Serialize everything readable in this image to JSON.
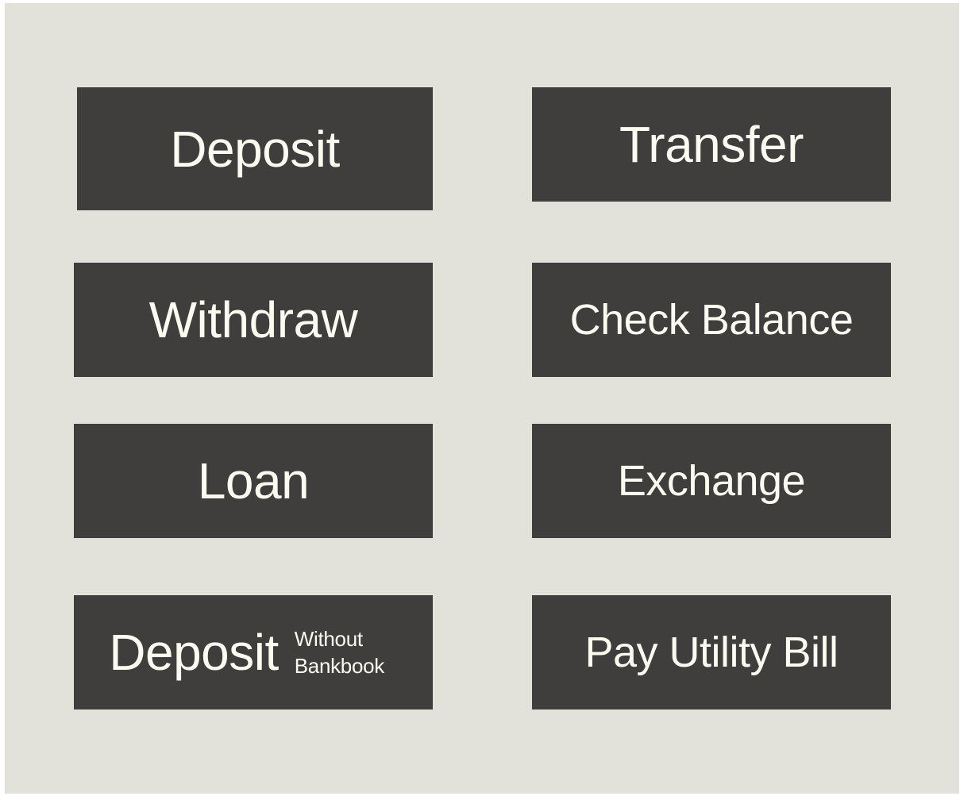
{
  "menu": {
    "deposit": {
      "label": "Deposit"
    },
    "transfer": {
      "label": "Transfer"
    },
    "withdraw": {
      "label": "Withdraw"
    },
    "check_balance": {
      "label": "Check Balance"
    },
    "loan": {
      "label": "Loan"
    },
    "exchange": {
      "label": "Exchange"
    },
    "deposit_without_bankbook": {
      "label": "Deposit",
      "sub_label_line1": "Without",
      "sub_label_line2": "Bankbook"
    },
    "pay_utility_bill": {
      "label": "Pay Utility Bill"
    }
  },
  "colors": {
    "background": "#e2e2da",
    "tile": "#3f3e3c",
    "text": "#fbfbf2"
  }
}
